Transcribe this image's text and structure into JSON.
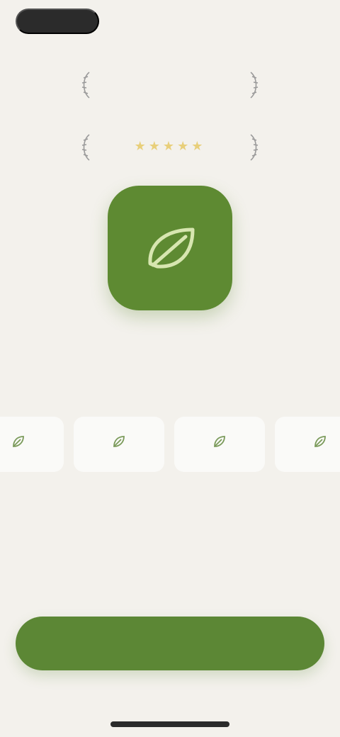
{
  "header": {
    "back_label": "",
    "top_right_label": ""
  },
  "award": {
    "title": "",
    "subtitle": ""
  },
  "rating": {
    "stars": "★★★★★",
    "subtitle": ""
  },
  "app": {
    "name": "",
    "tagline": "",
    "accent_color": "#5e8a32"
  },
  "features": [
    {
      "label": "",
      "icon": "leaf-icon"
    },
    {
      "label": "",
      "icon": "leaf-icon"
    },
    {
      "label": "",
      "icon": "leaf-icon"
    },
    {
      "label": "",
      "icon": "leaf-icon"
    }
  ],
  "cta": {
    "label": ""
  }
}
